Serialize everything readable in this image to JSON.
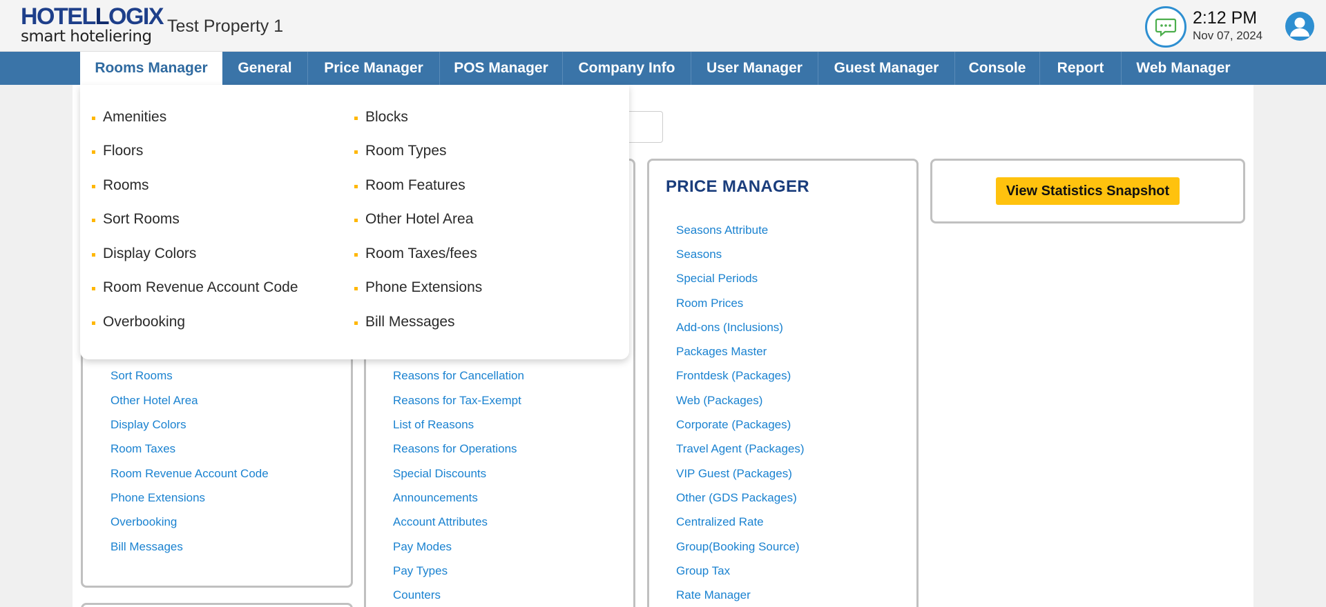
{
  "header": {
    "logo_main_a": "HOTEL",
    "logo_main_b": "OGIX",
    "logo_main_l": "L",
    "logo_tagline": "smart hoteliering",
    "property_name": "Test Property 1",
    "time": "2:12 PM",
    "date": "Nov 07, 2024"
  },
  "nav": {
    "items": [
      "Rooms Manager",
      "General",
      "Price Manager",
      "POS Manager",
      "Company Info",
      "User Manager",
      "Guest Manager",
      "Console",
      "Report",
      "Web Manager"
    ],
    "active": "Rooms Manager"
  },
  "dropdown": {
    "left": [
      "Amenities",
      "Floors",
      "Rooms",
      "Sort Rooms",
      "Display Colors",
      "Room Revenue Account Code",
      "Overbooking"
    ],
    "right": [
      "Blocks",
      "Room Types",
      "Room Features",
      "Other Hotel Area",
      "Room Taxes/fees",
      "Phone Extensions",
      "Bill Messages"
    ]
  },
  "rooms_panel": {
    "links": [
      "Sort Rooms",
      "Other Hotel Area",
      "Display Colors",
      "Room Taxes",
      "Room Revenue Account Code",
      "Phone Extensions",
      "Overbooking",
      "Bill Messages"
    ]
  },
  "general_panel": {
    "links": [
      "Reasons for Cancellation",
      "Reasons for Tax-Exempt",
      "List of Reasons",
      "Reasons for Operations",
      "Special Discounts",
      "Announcements",
      "Account Attributes",
      "Pay Modes",
      "Pay Types",
      "Counters"
    ]
  },
  "price_panel": {
    "title": "PRICE MANAGER",
    "links": [
      "Seasons Attribute",
      "Seasons",
      "Special Periods",
      "Room Prices",
      "Add-ons (Inclusions)",
      "Packages Master",
      "Frontdesk (Packages)",
      "Web (Packages)",
      "Corporate (Packages)",
      "Travel Agent (Packages)",
      "VIP Guest (Packages)",
      "Other (GDS Packages)",
      "Centralized Rate",
      "Group(Booking Source)",
      "Group Tax",
      "Rate Manager"
    ]
  },
  "stats_button": "View Statistics Snapshot",
  "colors": {
    "nav_bg": "#3a74a8",
    "link": "#1a82d0",
    "accent_yellow": "#ffc20e",
    "title_navy": "#1a3d7c"
  }
}
